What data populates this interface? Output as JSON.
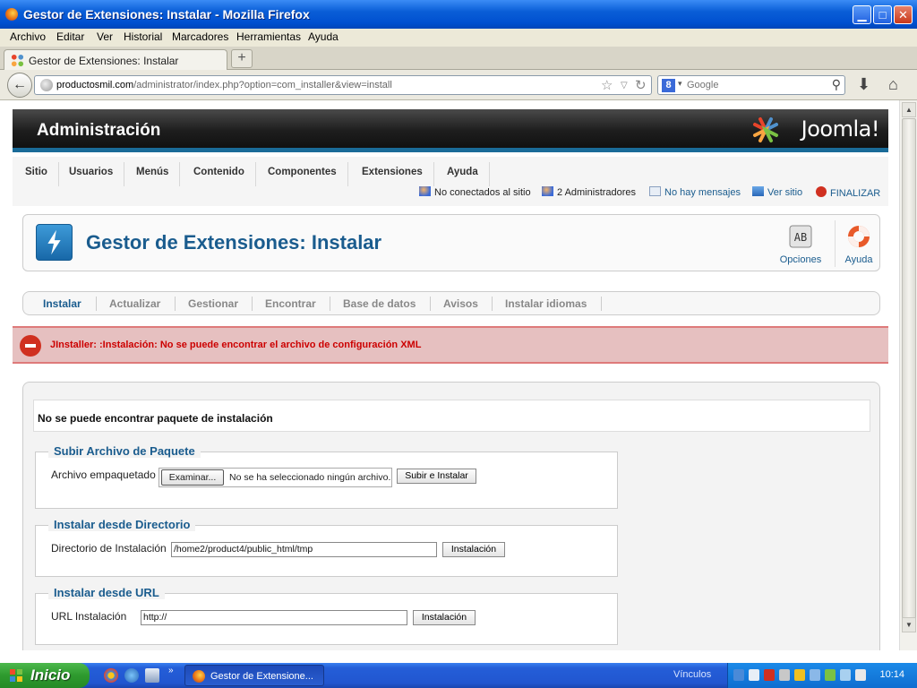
{
  "window": {
    "title": "Gestor de Extensiones: Instalar - Mozilla Firefox"
  },
  "menubar": {
    "items": [
      "Archivo",
      "Editar",
      "Ver",
      "Historial",
      "Marcadores",
      "Herramientas",
      "Ayuda"
    ]
  },
  "tab": {
    "title": "Gestor de Extensiones: Instalar",
    "new_tab": "+"
  },
  "navbar": {
    "url_domain": "productosmil.com",
    "url_path": "/administrator/index.php?option=com_installer&view=install",
    "search_placeholder": "Google"
  },
  "joomla": {
    "header_title": "Administración",
    "logo_text": "Joomla!",
    "nav": [
      "Sitio",
      "Usuarios",
      "Menús",
      "Contenido",
      "Componentes",
      "Extensiones",
      "Ayuda"
    ],
    "status": {
      "not_connected": "No conectados al sitio",
      "admins": "2 Administradores",
      "messages": "No hay mensajes",
      "view_site": "Ver sitio",
      "logout": "FINALIZAR"
    },
    "page_title": "Gestor de Extensiones: Instalar",
    "toolbar": {
      "options": "Opciones",
      "help": "Ayuda"
    },
    "submenu": [
      "Instalar",
      "Actualizar",
      "Gestionar",
      "Encontrar",
      "Base de datos",
      "Avisos",
      "Instalar idiomas"
    ],
    "error": "JInstaller: :Instalación: No se puede encontrar el archivo de configuración XML",
    "message": "No se puede encontrar paquete de instalación",
    "upload": {
      "legend": "Subir Archivo de Paquete",
      "label": "Archivo empaquetado",
      "browse": "Examinar...",
      "no_file": "No se ha seleccionado ningún archivo.",
      "submit": "Subir e Instalar"
    },
    "directory": {
      "legend": "Instalar desde Directorio",
      "label": "Directorio de Instalación",
      "value": "/home2/product4/public_html/tmp",
      "submit": "Instalación"
    },
    "url": {
      "legend": "Instalar desde URL",
      "label": "URL Instalación",
      "value": "http://",
      "submit": "Instalación"
    }
  },
  "taskbar": {
    "start": "Inicio",
    "task": "Gestor de Extensione...",
    "links": "Vínculos",
    "clock": "10:14"
  },
  "colors": {
    "accent": "#1a5c8e",
    "error_bg": "#e6c0c0",
    "error_text": "#cc0000",
    "header_dark": "#1e1e1e",
    "header_stripe": "#1a6b98"
  }
}
